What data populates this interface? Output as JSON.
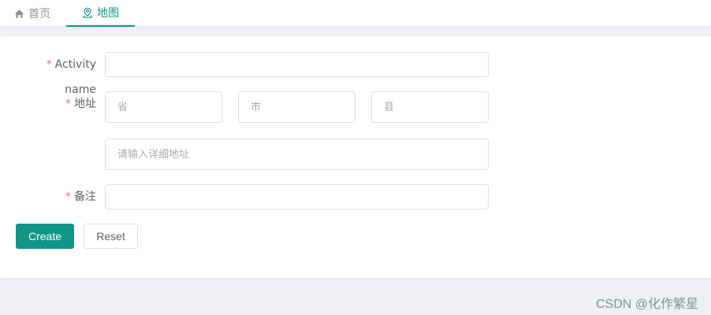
{
  "tabs": {
    "home": {
      "label": "首页",
      "icon": "home-icon"
    },
    "map": {
      "label": "地图",
      "icon": "map-pin-icon",
      "active": true
    }
  },
  "accent_color": "#0f9686",
  "required_color": "#f56c6c",
  "form": {
    "activity_name": {
      "label": "Activity name",
      "value": "",
      "required": true
    },
    "address": {
      "label": "地址",
      "required": true,
      "province_placeholder": "省",
      "city_placeholder": "市",
      "county_placeholder": "县",
      "detail_placeholder": "请输入详细地址"
    },
    "remark": {
      "label": "备注",
      "value": "",
      "required": true
    },
    "required_mark": "*"
  },
  "buttons": {
    "create": "Create",
    "reset": "Reset"
  },
  "watermark": "CSDN @化作繁星"
}
